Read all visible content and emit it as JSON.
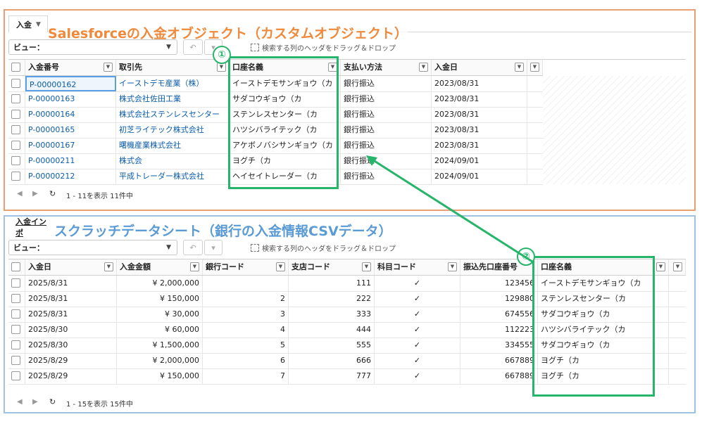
{
  "top": {
    "tab_label": "入金",
    "overlay_title": "Salesforceの入金オブジェクト（カスタムオブジェクト）",
    "view_label": "ビュー：",
    "drag_hint": "検索する列のヘッダをドラッグ＆ドロップ",
    "columns": [
      "入金番号",
      "取引先",
      "口座名義",
      "支払い方法",
      "入金日"
    ],
    "rows": [
      [
        "P-00000162",
        "イーストデモ産業（株）",
        "イーストデモサンギョウ（カ",
        "銀行振込",
        "2023/08/31"
      ],
      [
        "P-00000163",
        "株式会社佐田工業",
        "サダコウギョウ（カ",
        "銀行振込",
        "2023/08/31"
      ],
      [
        "P-00000164",
        "株式会社ステンレスセンター",
        "ステンレスセンター（カ",
        "銀行振込",
        "2023/08/31"
      ],
      [
        "P-00000165",
        "初芝ライテック株式会社",
        "ハツシバライテック（カ",
        "銀行振込",
        "2023/08/31"
      ],
      [
        "P-00000167",
        "曙機産業株式会社",
        "アケボノバシサンギョウ（カ",
        "銀行振込",
        "2023/08/31"
      ],
      [
        "P-00000211",
        "株式会",
        "ヨグチ（カ",
        "銀行振込",
        "2024/09/01"
      ],
      [
        "P-00000212",
        "平成トレーダー株式会社",
        "ヘイセイトレーダー（カ",
        "銀行振込",
        "2024/09/01"
      ]
    ],
    "footer": "1 - 11を表示 11件中",
    "marker": "①"
  },
  "bottom": {
    "tab_label": "入金インポ",
    "overlay_title": "スクラッチデータシート（銀行の入金情報CSVデータ）",
    "view_label": "ビュー：",
    "drag_hint": "検索する列のヘッダをドラッグ＆ドロップ",
    "columns": [
      "入金日",
      "入金金額",
      "銀行コード",
      "支店コード",
      "科目コード",
      "振込先口座番号",
      "口座名義"
    ],
    "rows": [
      [
        "2025/8/31",
        "¥ 2,000,000",
        "",
        "111",
        "✓",
        "123456",
        "イーストデモサンギョウ（カ"
      ],
      [
        "2025/8/31",
        "¥ 150,000",
        "2",
        "222",
        "✓",
        "129880",
        "ステンレスセンター（カ"
      ],
      [
        "2025/8/31",
        "¥ 30,000",
        "3",
        "333",
        "✓",
        "674556",
        "サダコウギョウ（カ"
      ],
      [
        "2025/8/30",
        "¥ 60,000",
        "4",
        "444",
        "✓",
        "112223",
        "ハツシバライテック（カ"
      ],
      [
        "2025/8/30",
        "¥ 1,500,000",
        "5",
        "555",
        "✓",
        "334555",
        "サダコウギョウ（カ"
      ],
      [
        "2025/8/29",
        "¥ 2,000,000",
        "6",
        "666",
        "✓",
        "667889",
        "ヨグチ（カ"
      ],
      [
        "2025/8/29",
        "¥ 150,000",
        "7",
        "777",
        "✓",
        "667889",
        "ヨグチ（カ"
      ]
    ],
    "footer": "1 - 15を表示 15件中",
    "marker": "②"
  },
  "colors": {
    "top_frame": "#e8a070",
    "bottom_frame": "#9ec2e0",
    "top_title": "#ef8a3c",
    "bottom_title": "#5b9bd5",
    "highlight": "#26b56a",
    "link": "#0b5cab"
  },
  "icons": {
    "undo": "undo-icon",
    "refresh": "refresh-icon",
    "prev": "prev-page-icon",
    "next": "next-page-icon",
    "checkbox": "checkbox-icon",
    "sort": "column-menu-icon"
  }
}
